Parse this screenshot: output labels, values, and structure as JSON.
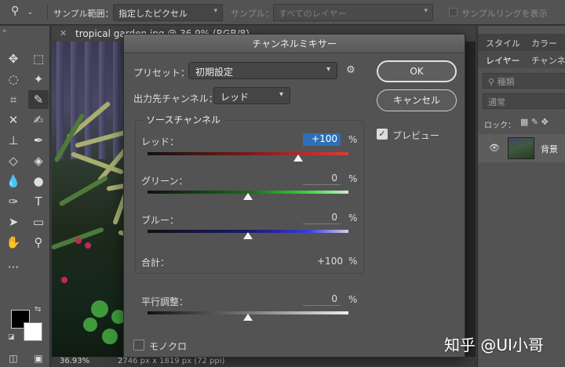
{
  "options_bar": {
    "sample_size_label": "サンプル範囲：",
    "sample_size_value": "指定したピクセル",
    "sample_label": "サンプル：",
    "sample_value": "すべてのレイヤー",
    "show_sampling_ring_label": "サンプルリングを表示"
  },
  "document": {
    "tab_title": "tropical garden.jpg @ 36.9% (RGB/8)",
    "zoom": "36.93%",
    "dimensions": "2746 px x 1819 px (72 ppi)"
  },
  "right_panel": {
    "top_tabs": [
      "スタイル",
      "カラー"
    ],
    "layer_tabs": [
      "レイヤー",
      "チャンネル"
    ],
    "search_placeholder": "種類",
    "blend_mode": "通常",
    "lock_label": "ロック：",
    "layer_name": "背景"
  },
  "dialog": {
    "title": "チャンネルミキサー",
    "preset_label": "プリセット：",
    "preset_value": "初期設定",
    "output_channel_label": "出力先チャンネル：",
    "output_channel_value": "レッド",
    "source_group_title": "ソースチャンネル",
    "percent": "%",
    "red_label": "レッド：",
    "red_value": "+100",
    "red_level": 100,
    "green_label": "グリーン：",
    "green_value": "0",
    "green_level": 0,
    "blue_label": "ブルー：",
    "blue_value": "0",
    "blue_level": 0,
    "total_label": "合計：",
    "total_value": "+100",
    "constant_label": "平行調整：",
    "constant_value": "0",
    "constant_level": 0,
    "monochrome_label": "モノクロ",
    "monochrome_checked": false,
    "ok_label": "OK",
    "cancel_label": "キャンセル",
    "preview_label": "プレビュー",
    "preview_checked": true
  },
  "colors": {
    "red_track_end": "#e03a3a",
    "green_track_end": "#3ad43a",
    "blue_track_end": "#3a3ae0",
    "highlight": "#2f6fb7"
  },
  "watermark": "知乎 @UI小哥"
}
